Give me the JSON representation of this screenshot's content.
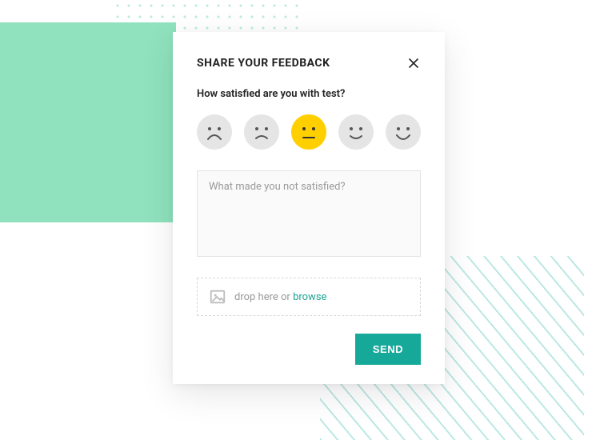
{
  "header": {
    "title": "SHARE YOUR FEEDBACK"
  },
  "question": "How satisfied are you with test?",
  "rating": {
    "options": [
      {
        "id": "very-unsatisfied",
        "selected": false
      },
      {
        "id": "unsatisfied",
        "selected": false
      },
      {
        "id": "neutral",
        "selected": true
      },
      {
        "id": "satisfied",
        "selected": false
      },
      {
        "id": "very-satisfied",
        "selected": false
      }
    ]
  },
  "feedback": {
    "placeholder": "What made you not satisfied?",
    "value": ""
  },
  "upload": {
    "prefix": "drop here or ",
    "browse": "browse"
  },
  "actions": {
    "send": "SEND"
  },
  "colors": {
    "accent": "#16a99a",
    "selected_face": "#ffcf00",
    "mint": "#8fe2bd"
  }
}
